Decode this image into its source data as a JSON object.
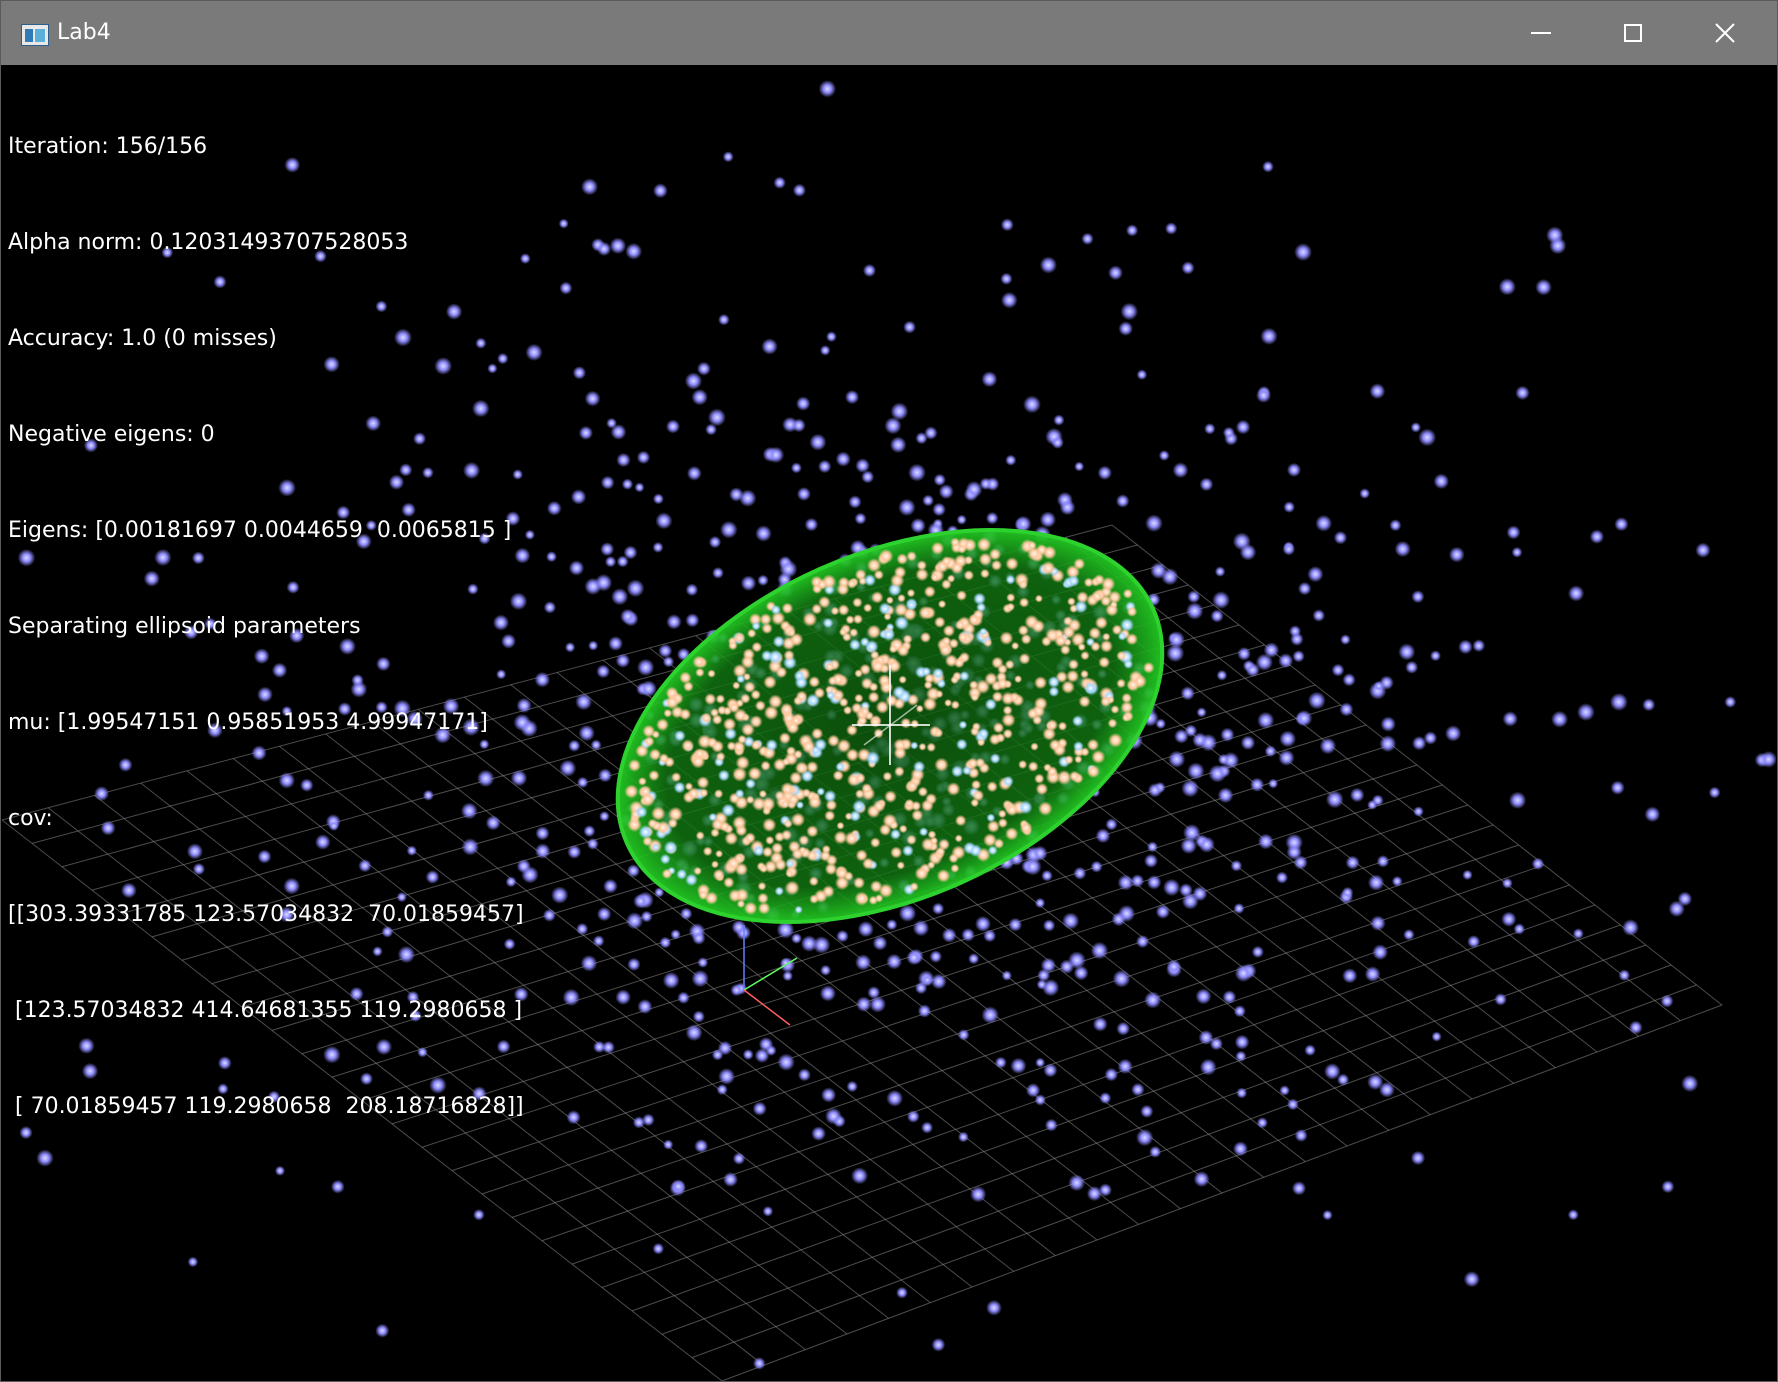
{
  "window": {
    "title": "Lab4",
    "icon": "app-window-icon",
    "controls": {
      "minimize": "minimize-icon",
      "maximize": "maximize-icon",
      "close": "close-icon"
    }
  },
  "info": {
    "lines": [
      "Iteration: 156/156",
      "Alpha norm: 0.12031493707528053",
      "Accuracy: 1.0 (0 misses)",
      "Negative eigens: 0",
      "Eigens: [0.00181697 0.0044659  0.0065815 ]",
      "Separating ellipsoid parameters",
      "mu: [1.99547151 0.95851953 4.99947171]",
      "cov:",
      "[[303.39331785 123.57034832  70.01859457]",
      " [123.57034832 414.64681355 119.2980658 ]",
      " [ 70.01859457 119.2980658  208.18716828]]"
    ]
  },
  "scene": {
    "colors": {
      "background": "#000000",
      "grid": "#8a8a8a",
      "outer_points": "#8f8cff",
      "inner_points": "#ffc9a0",
      "inner_points_alt": "#a8d8ff",
      "ellipsoid": "#1fae1f",
      "axis_x": "#ff6060",
      "axis_y": "#60ff60",
      "axis_z": "#6080ff"
    }
  }
}
